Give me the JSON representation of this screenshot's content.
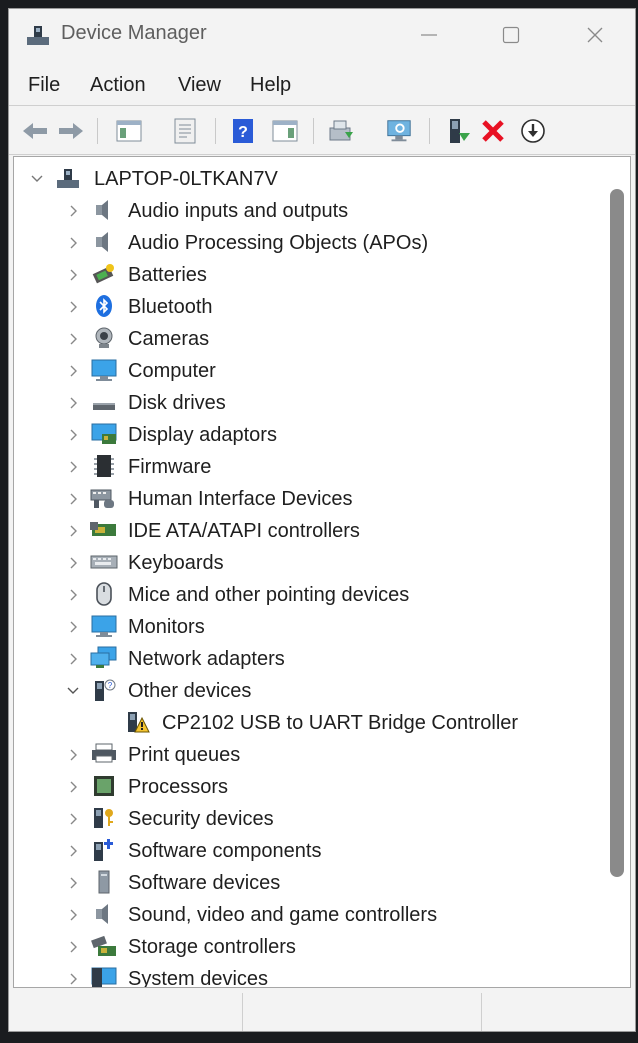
{
  "window": {
    "title": "Device Manager"
  },
  "menu": [
    "File",
    "Action",
    "View",
    "Help"
  ],
  "toolbar": [
    {
      "name": "back-arrow-icon"
    },
    {
      "name": "forward-arrow-icon"
    },
    {
      "name": "show-hide-console-tree-icon"
    },
    {
      "name": "properties-icon"
    },
    {
      "name": "help-icon"
    },
    {
      "name": "action-pane-icon"
    },
    {
      "name": "update-driver-icon"
    },
    {
      "name": "scan-hardware-icon"
    },
    {
      "name": "enable-device-icon"
    },
    {
      "name": "uninstall-device-icon"
    },
    {
      "name": "download-driver-icon"
    }
  ],
  "tree": {
    "root": "LAPTOP-0LTKAN7V",
    "items": [
      {
        "label": "Audio inputs and outputs",
        "icon": "speaker-icon",
        "expanded": false
      },
      {
        "label": "Audio Processing Objects (APOs)",
        "icon": "speaker-icon",
        "expanded": false
      },
      {
        "label": "Batteries",
        "icon": "battery-icon",
        "expanded": false
      },
      {
        "label": "Bluetooth",
        "icon": "bluetooth-icon",
        "expanded": false
      },
      {
        "label": "Cameras",
        "icon": "camera-icon",
        "expanded": false
      },
      {
        "label": "Computer",
        "icon": "computer-icon",
        "expanded": false
      },
      {
        "label": "Disk drives",
        "icon": "disk-drive-icon",
        "expanded": false
      },
      {
        "label": "Display adaptors",
        "icon": "display-adapter-icon",
        "expanded": false
      },
      {
        "label": "Firmware",
        "icon": "firmware-chip-icon",
        "expanded": false
      },
      {
        "label": "Human Interface Devices",
        "icon": "hid-icon",
        "expanded": false
      },
      {
        "label": "IDE ATA/ATAPI controllers",
        "icon": "ide-controller-icon",
        "expanded": false
      },
      {
        "label": "Keyboards",
        "icon": "keyboard-icon",
        "expanded": false
      },
      {
        "label": "Mice and other pointing devices",
        "icon": "mouse-icon",
        "expanded": false
      },
      {
        "label": "Monitors",
        "icon": "monitor-icon",
        "expanded": false
      },
      {
        "label": "Network adapters",
        "icon": "network-adapter-icon",
        "expanded": false
      },
      {
        "label": "Other devices",
        "icon": "unknown-device-icon",
        "expanded": true,
        "children": [
          {
            "label": "CP2102 USB to UART Bridge Controller",
            "icon": "warning-device-icon"
          }
        ]
      },
      {
        "label": "Print queues",
        "icon": "printer-icon",
        "expanded": false
      },
      {
        "label": "Processors",
        "icon": "processor-icon",
        "expanded": false
      },
      {
        "label": "Security devices",
        "icon": "security-key-icon",
        "expanded": false
      },
      {
        "label": "Software components",
        "icon": "software-component-icon",
        "expanded": false
      },
      {
        "label": "Software devices",
        "icon": "software-device-icon",
        "expanded": false
      },
      {
        "label": "Sound, video and game controllers",
        "icon": "speaker-icon",
        "expanded": false
      },
      {
        "label": "Storage controllers",
        "icon": "storage-controller-icon",
        "expanded": false
      },
      {
        "label": "System devices",
        "icon": "system-devices-icon",
        "expanded": false
      }
    ]
  },
  "colors": {
    "window_bg": "#f3f3f3",
    "tree_bg": "#ffffff",
    "scrollbar": "#8a8a8a",
    "error_red": "#e81123",
    "help_blue": "#2a5bd7"
  }
}
